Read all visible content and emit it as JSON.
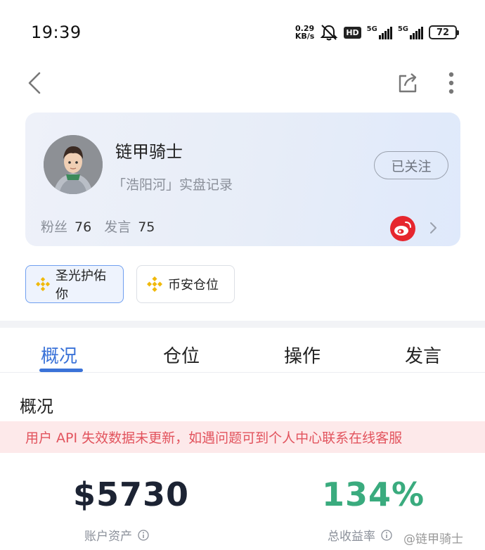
{
  "status_bar": {
    "time": "19:39",
    "net_speed_value": "0.29",
    "net_speed_unit": "KB/s",
    "hd_label": "HD",
    "signal1_label": "5G",
    "signal2_label": "5G",
    "battery_level": "72"
  },
  "profile": {
    "name": "链甲骑士",
    "subtitle": "「浩阳河」实盘记录",
    "follow_button": "已关注",
    "fans_label": "粉丝",
    "fans_count": "76",
    "posts_label": "发言",
    "posts_count": "75"
  },
  "chips": [
    {
      "label": "圣光护佑你",
      "active": true
    },
    {
      "label": "币安仓位",
      "active": false
    }
  ],
  "tabs": [
    {
      "label": "概况",
      "active": true
    },
    {
      "label": "仓位",
      "active": false
    },
    {
      "label": "操作",
      "active": false
    },
    {
      "label": "发言",
      "active": false
    }
  ],
  "section_title": "概况",
  "warning_text": "用户 API 失效数据未更新，如遇问题可到个人中心联系在线客服",
  "metrics": {
    "assets_value": "$5730",
    "assets_label": "账户资产",
    "return_value": "134%",
    "return_label": "总收益率"
  },
  "watermark": "@链甲骑士",
  "colors": {
    "accent": "#3a72d8",
    "return_green": "#3aab7e",
    "warning_text": "#e2535d",
    "warning_bg": "#fde9ea",
    "weibo_red": "#e6262e",
    "binance_yellow": "#f0b90b"
  }
}
